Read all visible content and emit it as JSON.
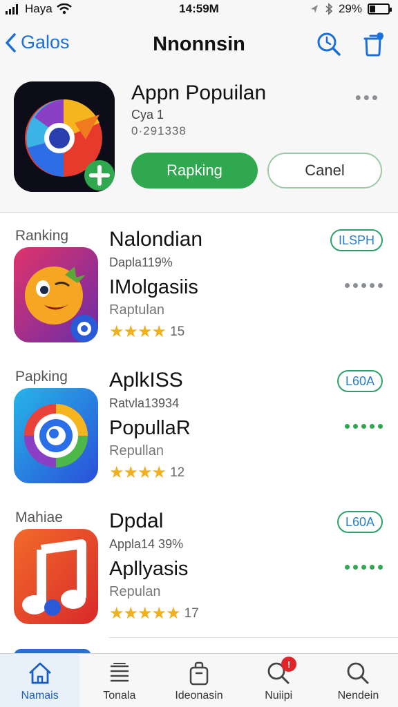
{
  "status_bar": {
    "carrier": "Haya",
    "time": "14:59M",
    "battery_text": "29%",
    "battery_level": 0.29
  },
  "nav": {
    "back_label": "Galos",
    "title": "Nnonnsin",
    "icons": [
      "search-icon",
      "trash-icon"
    ]
  },
  "header_app": {
    "title": "Appn Popuilan",
    "subtitle": "Cya 1",
    "meta": "0·291338",
    "primary_button": "Rapking",
    "secondary_button": "Canel",
    "more_label": "•••"
  },
  "list": [
    {
      "rank_label": "Ranking",
      "name": "Nalondian",
      "meta": "Dapla119%",
      "sub_name": "IMolgasiis",
      "category": "Raptulan",
      "stars": "★★★★",
      "rating_count": "15",
      "button_label": "ILSPH",
      "icon": "emoji-face-icon",
      "dot_color": "#8a8f94"
    },
    {
      "rank_label": "Papking",
      "name": "AplkISS",
      "meta": "Ratvla13934",
      "sub_name": "PopullaR",
      "category": "Repullan",
      "stars": "★★★★",
      "rating_count": "12",
      "button_label": "L60A",
      "icon": "spiral-icon",
      "dot_color": "#2fa84f"
    },
    {
      "rank_label": "Mahiae",
      "name": "Dpdal",
      "meta": "Appla14 39%",
      "sub_name": "Apllyasis",
      "category": "Repulan",
      "stars": "★★★★★",
      "rating_count": "17",
      "button_label": "L60A",
      "icon": "music-note-icon",
      "dot_color": "#2fa84f"
    }
  ],
  "tabs": [
    {
      "label": "Namais",
      "icon": "home-icon",
      "active": true
    },
    {
      "label": "Tonala",
      "icon": "list-icon",
      "active": false
    },
    {
      "label": "Ideonasin",
      "icon": "bag-icon",
      "active": false
    },
    {
      "label": "Nuiipi",
      "icon": "search-icon",
      "active": false,
      "badge": "!"
    },
    {
      "label": "Nendein",
      "icon": "search-icon",
      "active": false
    }
  ],
  "colors": {
    "accent_blue": "#1a6fd8",
    "primary_green": "#2fa84f",
    "star_yellow": "#f2b01e",
    "badge_red": "#e0242a"
  }
}
